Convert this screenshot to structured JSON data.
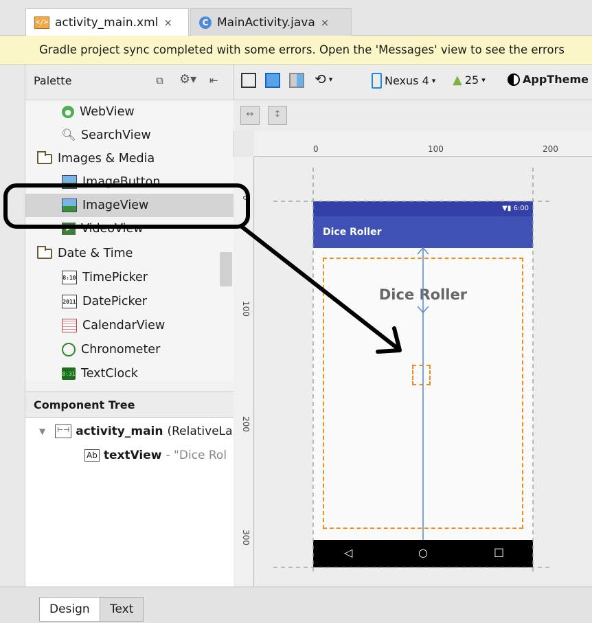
{
  "tabs": [
    {
      "label": "activity_main.xml",
      "close": "×"
    },
    {
      "label": "MainActivity.java",
      "close": "×"
    }
  ],
  "notification": "Gradle project sync completed with some errors. Open the 'Messages' view to see the errors",
  "palette": {
    "title": "Palette",
    "items": [
      {
        "label": "WebView"
      },
      {
        "label": "SearchView"
      },
      {
        "label": "Images & Media"
      },
      {
        "label": "ImageButton"
      },
      {
        "label": "ImageView"
      },
      {
        "label": "VideoView"
      },
      {
        "label": "Date & Time"
      },
      {
        "label": "TimePicker",
        "icon_text": "8:10"
      },
      {
        "label": "DatePicker",
        "icon_text": "2011"
      },
      {
        "label": "CalendarView"
      },
      {
        "label": "Chronometer"
      },
      {
        "label": "TextClock",
        "icon_text": "8:31"
      }
    ]
  },
  "component_tree": {
    "title": "Component Tree",
    "root_name": "activity_main",
    "root_detail": "(RelativeLa",
    "child_icon": "Ab",
    "child_name": "textView",
    "child_detail": "- \"Dice Rol"
  },
  "toolbar": {
    "device": "Nexus 4",
    "api": "25",
    "theme": "AppTheme"
  },
  "rulers": {
    "top": [
      "0",
      "100",
      "200"
    ],
    "left": [
      "0",
      "100",
      "200",
      "300"
    ]
  },
  "phone": {
    "status_time": "6:00",
    "app_title": "Dice Roller",
    "text_view": "Dice Roller"
  },
  "bottom_tabs": [
    "Design",
    "Text"
  ],
  "colors": {
    "notification_bg": "#fbf6c8",
    "app_bar": "#3f51b5",
    "status_bar": "#3240a8",
    "selection_orange": "#f08c1a"
  }
}
